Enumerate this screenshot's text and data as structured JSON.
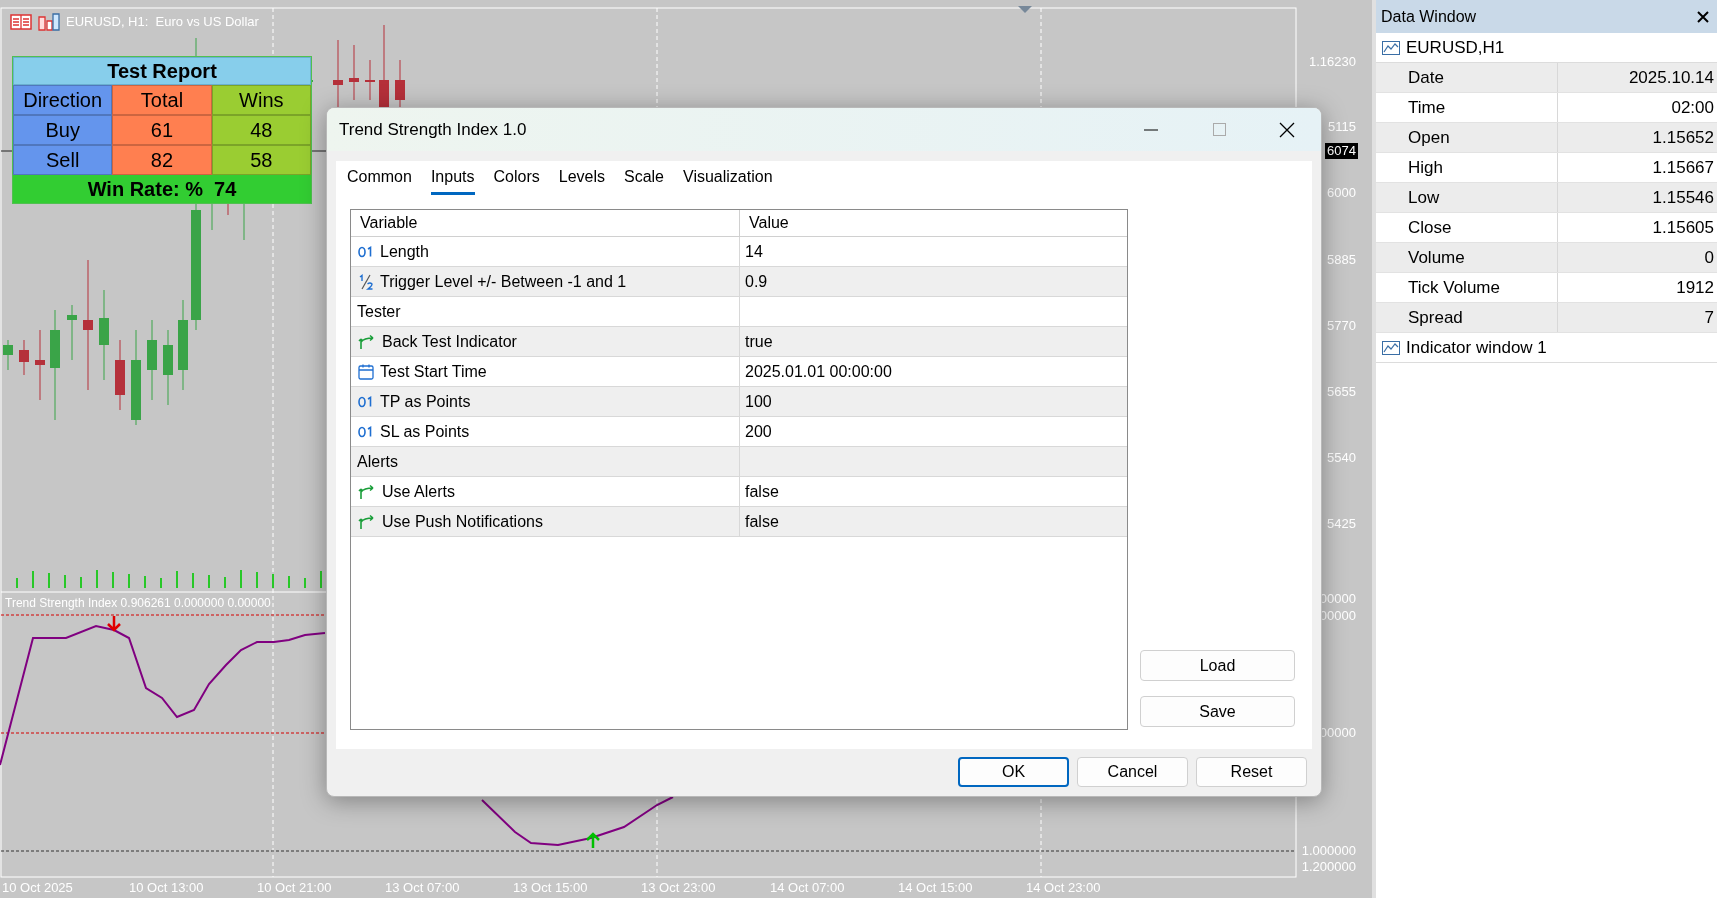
{
  "chart": {
    "header": "EURUSD, H1:  Euro vs US Dollar",
    "price_axis": [
      "1.16230",
      "5115",
      "6000",
      "5885",
      "5770",
      "5655",
      "5540",
      "5425"
    ],
    "current_price": "6074",
    "indicator_label": "Trend Strength Index 0.906261 0.000000 0.00000",
    "indicator_axis": [
      "00000",
      "00000",
      "00000",
      "1.000000",
      "1.200000"
    ],
    "time_axis": [
      "10 Oct 2025",
      "10 Oct 13:00",
      "10 Oct 21:00",
      "13 Oct 07:00",
      "13 Oct 15:00",
      "13 Oct 23:00",
      "14 Oct 07:00",
      "14 Oct 15:00",
      "14 Oct 23:00"
    ]
  },
  "test_report": {
    "title": "Test Report",
    "columns": [
      "Direction",
      "Total",
      "Wins"
    ],
    "rows": [
      [
        "Buy",
        "61",
        "48"
      ],
      [
        "Sell",
        "82",
        "58"
      ]
    ],
    "footer": "Win Rate: %  74"
  },
  "dialog": {
    "title": "Trend Strength Index 1.0",
    "tabs": [
      {
        "label": "Common",
        "selected": false
      },
      {
        "label": "Inputs",
        "selected": true
      },
      {
        "label": "Colors",
        "selected": false
      },
      {
        "label": "Levels",
        "selected": false
      },
      {
        "label": "Scale",
        "selected": false
      },
      {
        "label": "Visualization",
        "selected": false
      }
    ],
    "table": {
      "columns": [
        "Variable",
        "Value"
      ],
      "rows": [
        {
          "kind": "int",
          "variable": "Length",
          "value": "14"
        },
        {
          "kind": "double",
          "variable": "Trigger Level +/- Between -1 and 1",
          "value": "0.9"
        },
        {
          "kind": "group",
          "variable": "Tester"
        },
        {
          "kind": "bool",
          "variable": "Back Test Indicator",
          "value": "true"
        },
        {
          "kind": "datetime",
          "variable": "Test Start Time",
          "value": "2025.01.01 00:00:00"
        },
        {
          "kind": "int",
          "variable": "TP as Points",
          "value": "100"
        },
        {
          "kind": "int",
          "variable": "SL as Points",
          "value": "200"
        },
        {
          "kind": "group",
          "variable": "Alerts"
        },
        {
          "kind": "bool",
          "variable": "Use Alerts",
          "value": "false"
        },
        {
          "kind": "bool",
          "variable": "Use Push Notifications",
          "value": "false"
        }
      ]
    },
    "side_buttons": [
      "Load",
      "Save"
    ],
    "buttons": [
      {
        "label": "OK",
        "default": true
      },
      {
        "label": "Cancel",
        "default": false
      },
      {
        "label": "Reset",
        "default": false
      }
    ]
  },
  "data_window": {
    "title": "Data Window",
    "symbol": "EURUSD,H1",
    "rows": [
      {
        "label": "Date",
        "value": "2025.10.14"
      },
      {
        "label": "Time",
        "value": "02:00"
      },
      {
        "label": "Open",
        "value": "1.15652"
      },
      {
        "label": "High",
        "value": "1.15667"
      },
      {
        "label": "Low",
        "value": "1.15546"
      },
      {
        "label": "Close",
        "value": "1.15605"
      },
      {
        "label": "Volume",
        "value": "0"
      },
      {
        "label": "Tick Volume",
        "value": "1912"
      },
      {
        "label": "Spread",
        "value": "7"
      }
    ],
    "footer": "Indicator window 1"
  }
}
